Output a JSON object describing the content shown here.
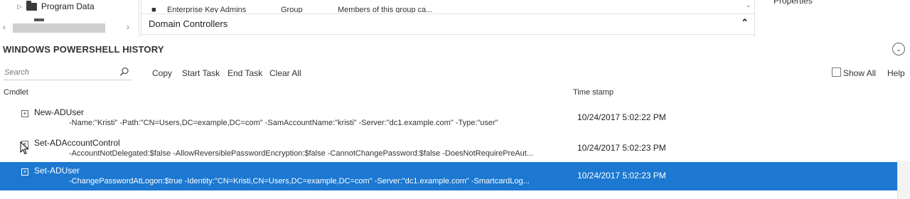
{
  "nav": {
    "tree_item": "Program Data"
  },
  "grid": {
    "cut_row": {
      "name": "Enterprise Key Admins",
      "type": "Group",
      "description": "Members of this group ca..."
    },
    "section": "Domain Controllers"
  },
  "tasks": {
    "properties": "Properties"
  },
  "history": {
    "title": "WINDOWS POWERSHELL HISTORY",
    "search_placeholder": "Search",
    "toolbar": {
      "copy": "Copy",
      "start_task": "Start Task",
      "end_task": "End Task",
      "clear_all": "Clear All",
      "show_all": "Show All",
      "help": "Help"
    },
    "columns": {
      "cmdlet": "Cmdlet",
      "timestamp": "Time stamp"
    },
    "rows": [
      {
        "name": "New-ADUser",
        "detail": "-Name:\"Kristi\" -Path:\"CN=Users,DC=example,DC=com\" -SamAccountName:\"kristi\" -Server:\"dc1.example.com\" -Type:\"user\"",
        "timestamp": "10/24/2017 5:02:22 PM",
        "selected": false
      },
      {
        "name": "Set-ADAccountControl",
        "detail": "-AccountNotDelegated:$false -AllowReversiblePasswordEncryption:$false -CannotChangePassword:$false -DoesNotRequirePreAut...",
        "timestamp": "10/24/2017 5:02:23 PM",
        "selected": false
      },
      {
        "name": "Set-ADUser",
        "detail": "-ChangePasswordAtLogon:$true -Identity:\"CN=Kristi,CN=Users,DC=example,DC=com\" -Server:\"dc1.example.com\" -SmartcardLog...",
        "timestamp": "10/24/2017 5:02:23 PM",
        "selected": true
      }
    ]
  },
  "colors": {
    "selection": "#1c78d0"
  },
  "icons": [
    "folder-icon",
    "search-icon",
    "expand-icon",
    "collapse-icon",
    "mouse-cursor-icon"
  ]
}
